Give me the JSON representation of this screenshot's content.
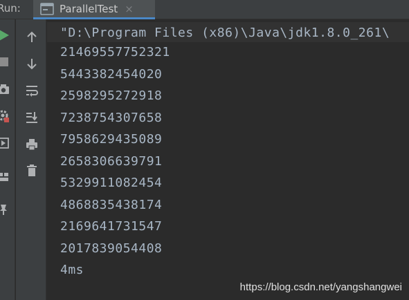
{
  "header": {
    "run_label": "Run:",
    "tab_title": "ParallelTest",
    "tab_close": "×"
  },
  "toolbar_outer": {
    "items": [
      "rerun-icon",
      "stop-icon",
      "camera-icon",
      "settings-icon",
      "exit-icon",
      "layout-icon",
      "pin-icon"
    ]
  },
  "toolbar_inner": {
    "items": [
      "arrow-up-icon",
      "arrow-down-icon",
      "soft-wrap-icon",
      "scroll-to-end-icon",
      "print-icon",
      "trash-icon"
    ]
  },
  "console": {
    "command": "\"D:\\Program Files (x86)\\Java\\jdk1.8.0_261\\",
    "lines": [
      "21469557752321",
      "5443382454020",
      "2598295272918",
      "7238754307658",
      "7958629435089",
      "2658306639791",
      "5329911082454",
      "4868835438174",
      "2169641731547",
      "2017839054408",
      "4ms"
    ]
  },
  "watermark": "https://blog.csdn.net/yangshangwei",
  "colors": {
    "accent": "#4a88c7",
    "run_green": "#59a869",
    "console_text": "#a9b7c6"
  }
}
